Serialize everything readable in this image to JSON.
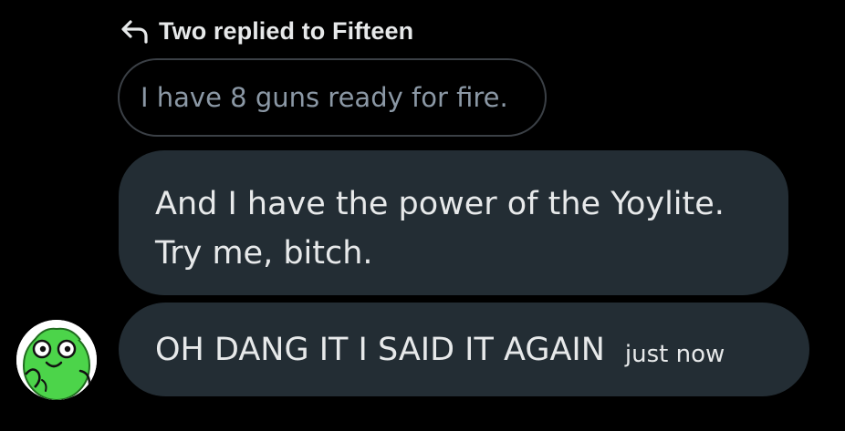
{
  "reply_header": {
    "icon": "reply-arrow-icon",
    "text": "Two replied to Fifteen"
  },
  "quoted_message": {
    "text": "I have 8 guns ready for fire."
  },
  "messages": [
    {
      "lines": [
        "And I have the power of the Yoylite.",
        "Try me, bitch."
      ]
    },
    {
      "lines": [
        "OH DANG IT I SAID IT AGAIN"
      ],
      "timestamp": "just now"
    }
  ],
  "avatar": {
    "icon": "green-character-avatar-icon"
  },
  "colors": {
    "background": "#000000",
    "bubble": "#232d34",
    "quoted_border": "#3b4046",
    "quoted_text": "#8b98a5",
    "text": "#e7e9ea",
    "avatar_green": "#4cd44a"
  }
}
